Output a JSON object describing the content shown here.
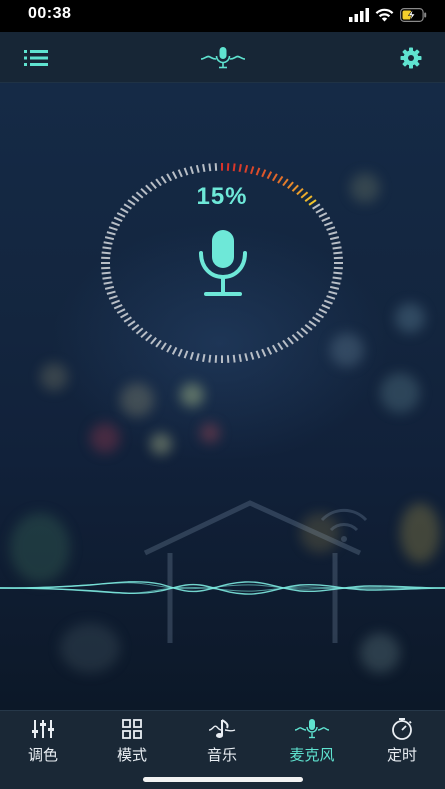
{
  "status_bar": {
    "time": "00:38"
  },
  "toolbar": {
    "left_icon": "list-icon",
    "center_icon": "microphone-wave-icon",
    "right_icon": "gear-icon"
  },
  "mic_meter": {
    "level_percent": "15%",
    "level": 0.15
  },
  "tabs": [
    {
      "label": "调色",
      "icon": "sliders-icon",
      "active": false
    },
    {
      "label": "模式",
      "icon": "grid-icon",
      "active": false
    },
    {
      "label": "音乐",
      "icon": "music-note-icon",
      "active": false
    },
    {
      "label": "麦克风",
      "icon": "microphone-wave-icon",
      "active": true
    },
    {
      "label": "定时",
      "icon": "timer-icon",
      "active": false
    }
  ],
  "colors": {
    "accent": "#5fe3d0",
    "meter_red": "#d9322a",
    "meter_yellow": "#f0c62c",
    "meter_inactive": "#b8bec6"
  }
}
